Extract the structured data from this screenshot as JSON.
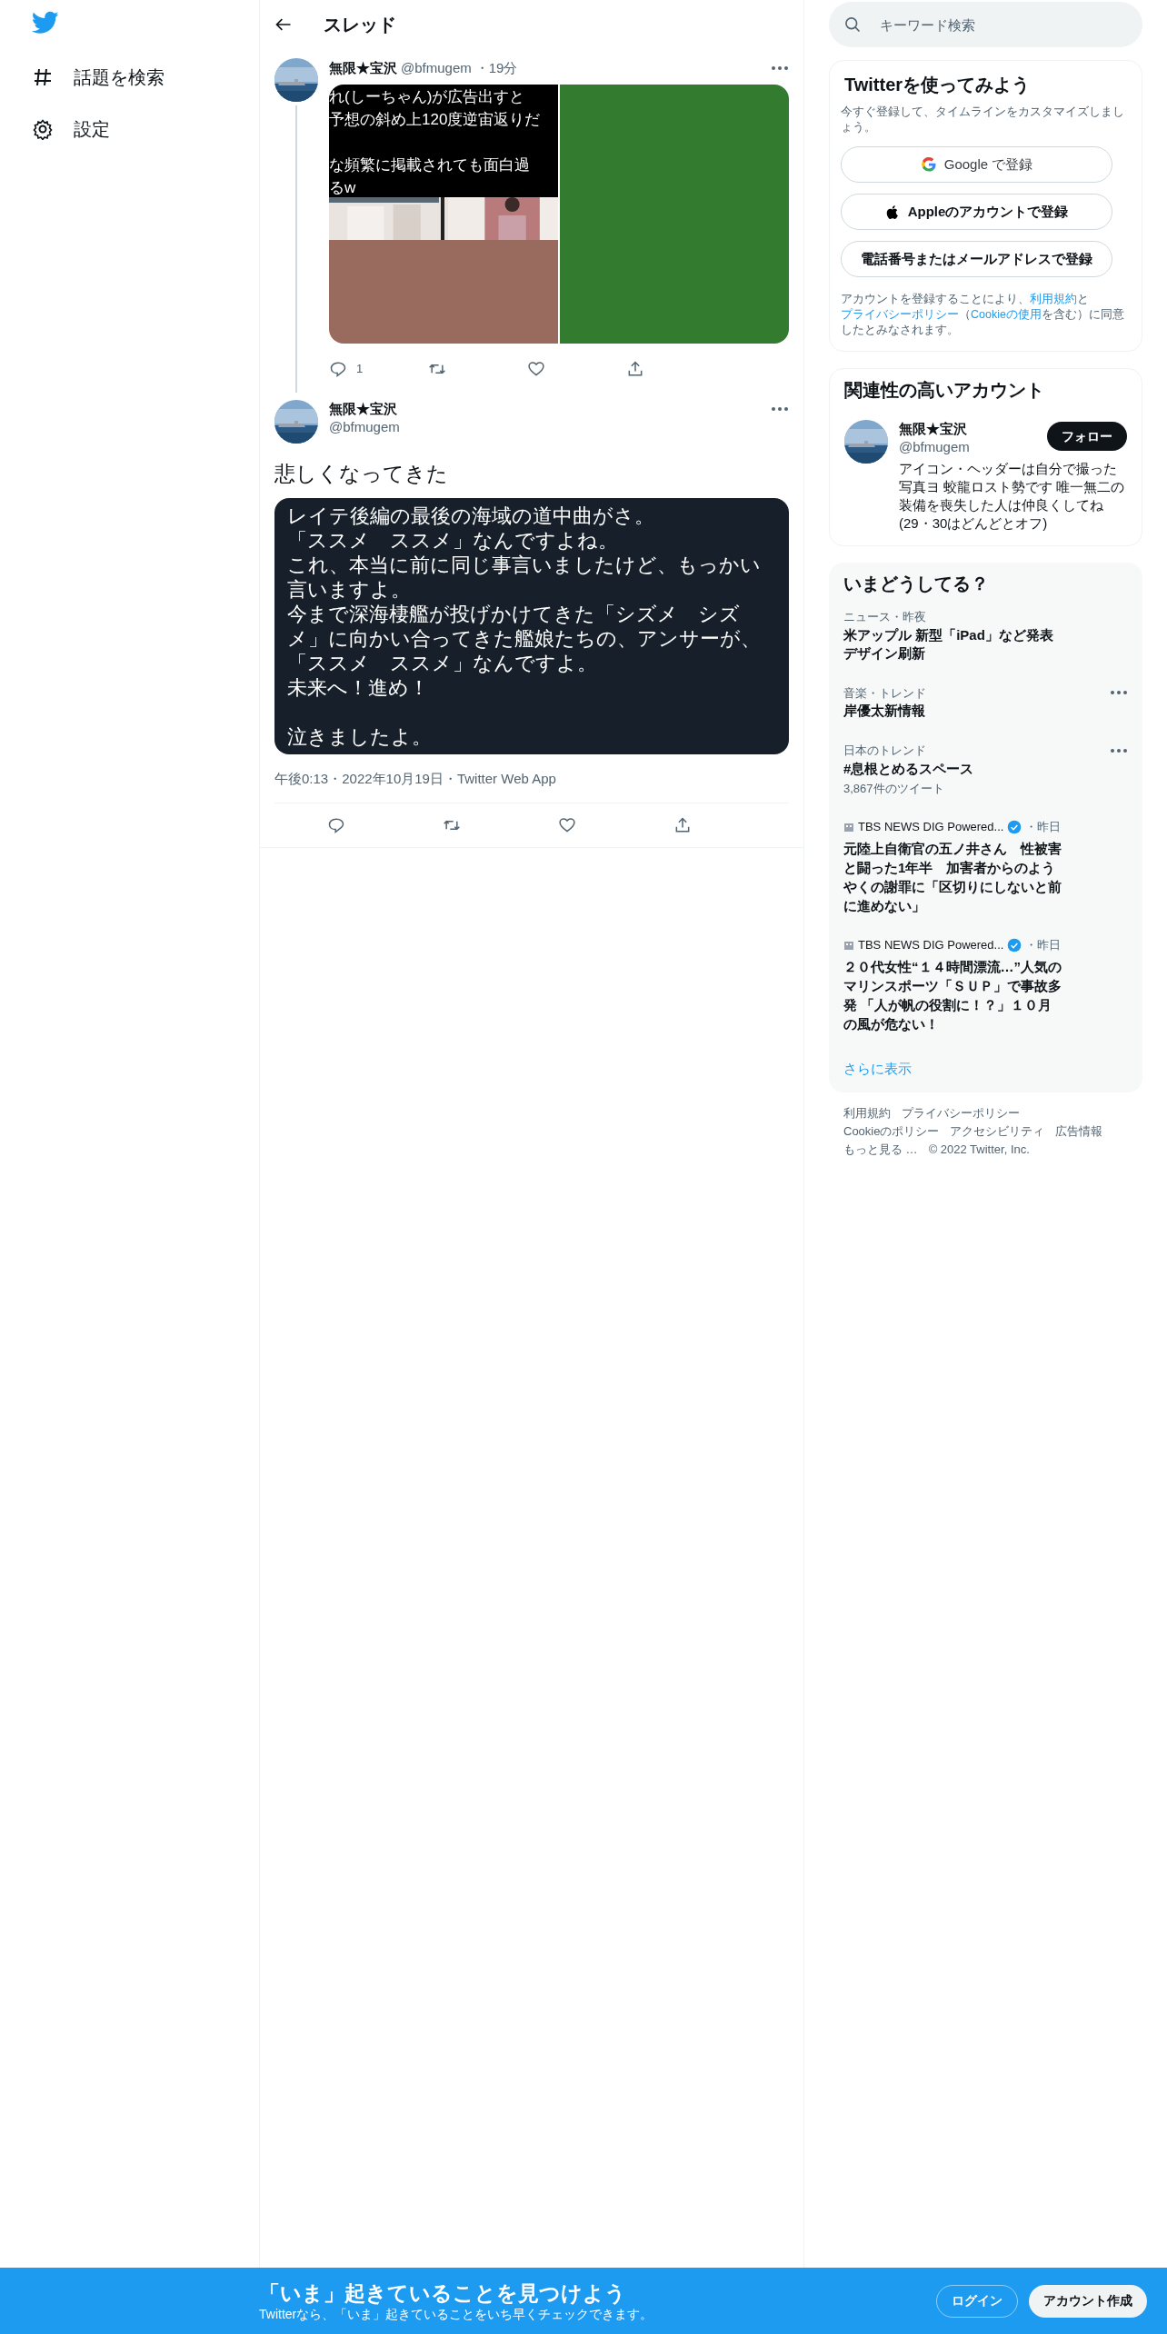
{
  "sidebar": {
    "items": [
      {
        "kind": "hashtag",
        "label": "話題を検索"
      },
      {
        "kind": "settings",
        "label": "設定"
      }
    ]
  },
  "header": {
    "title": "スレッド"
  },
  "tweets": [
    {
      "name": "無限★宝沢",
      "handle": "@bfmugem",
      "time": "・19分",
      "media": {
        "paragraphs": [
          [
            "れ(しーちゃん)が広告出すと",
            "予想の斜め上120度逆宙返りだ"
          ],
          [
            "な頻繁に掲載されても面白過",
            "るw"
          ]
        ]
      },
      "actions": [
        {
          "kind": "reply",
          "count": "1"
        },
        {
          "kind": "retweet"
        },
        {
          "kind": "like"
        },
        {
          "kind": "share"
        }
      ]
    },
    {
      "name": "無限★宝沢",
      "handle": "@bfmugem",
      "text": "悲しくなってきた",
      "text_image": [
        [
          "レイテ後編の最後の海域の道中曲がさ。",
          "「ススメ　ススメ」なんですよね。",
          "これ、本当に前に同じ事言いましたけど、もっかい言いますよ。",
          "今まで深海棲艦が投げかけてきた「シズメ　シズメ」に向かい合ってきた艦娘たちの、アンサーが、「ススメ　ススメ」なんですよ。",
          "未来へ！進め！"
        ],
        [
          "泣きましたよ。"
        ]
      ],
      "timestamp": "午後0:13・2022年10月19日・Twitter Web App",
      "actions": [
        {
          "kind": "reply"
        },
        {
          "kind": "retweet"
        },
        {
          "kind": "like"
        },
        {
          "kind": "share"
        }
      ]
    }
  ],
  "search": {
    "placeholder": "キーワード検索"
  },
  "signup": {
    "title": "Twitterを使ってみよう",
    "subtitle": "今すぐ登録して、タイムラインをカスタマイズしましょう。",
    "buttons": [
      {
        "kind": "google",
        "label": "Google で登録"
      },
      {
        "kind": "apple",
        "label": "Appleのアカウントで登録"
      },
      {
        "kind": "plain",
        "label": "電話番号またはメールアドレスで登録"
      }
    ],
    "legal": [
      {
        "text": "アカウントを登録することにより、",
        "link": false
      },
      {
        "text": "利用規約",
        "link": true
      },
      {
        "text": "と",
        "link": false
      },
      {
        "text": "プライバシーポリシー",
        "link": true
      },
      {
        "text": "（",
        "link": false
      },
      {
        "text": "Cookieの使用",
        "link": true
      },
      {
        "text": "を含む）に同意したとみなされます。",
        "link": false
      }
    ]
  },
  "related": {
    "title": "関連性の高いアカウント",
    "account": {
      "name": "無限★宝沢",
      "handle": "@bfmugem",
      "bio": "アイコン・ヘッダーは自分で撮った写真ヨ 蛟龍ロスト勢です 唯一無二の装備を喪失した人は仲良くしてね (29・30はどんどとオフ)",
      "button": "フォロー"
    }
  },
  "trends": {
    "title": "いまどうしてる？",
    "items": [
      {
        "kind": "trend",
        "meta": "ニュース・昨夜",
        "title": "米アップル 新型「iPad」など発表デザイン刷新",
        "more": false
      },
      {
        "kind": "trend",
        "meta": "音楽・トレンド",
        "title": "岸優太新情報",
        "more": true
      },
      {
        "kind": "trend",
        "meta": "日本のトレンド",
        "title": "#息根とめるスペース",
        "count": "3,867件のツイート",
        "more": true
      },
      {
        "kind": "news",
        "source": "TBS NEWS DIG Powered...",
        "time": "・昨日",
        "title": "元陸上自衛官の五ノ井さん　性被害と闘った1年半　加害者からのようやくの謝罪に「区切りにしないと前に進めない」"
      },
      {
        "kind": "news",
        "source": "TBS NEWS DIG Powered...",
        "time": "・昨日",
        "title": "２０代女性“１４時間漂流…”人気のマリンスポーツ「ＳＵＰ」で事故多発 「人が帆の役割に！？」１０月の風が危ない！"
      }
    ],
    "show_more": "さらに表示"
  },
  "footer": [
    [
      "利用規約",
      "プライバシーポリシー"
    ],
    [
      "Cookieのポリシー",
      "アクセシビリティ",
      "広告情報"
    ],
    [
      "もっと見る …",
      "© 2022 Twitter, Inc."
    ]
  ],
  "bottom_bar": {
    "title": "「いま」起きていることを見つけよう",
    "subtitle": "Twitterなら、「いま」起きていることをいち早くチェックできます。",
    "login": "ログイン",
    "signup": "アカウント作成"
  }
}
